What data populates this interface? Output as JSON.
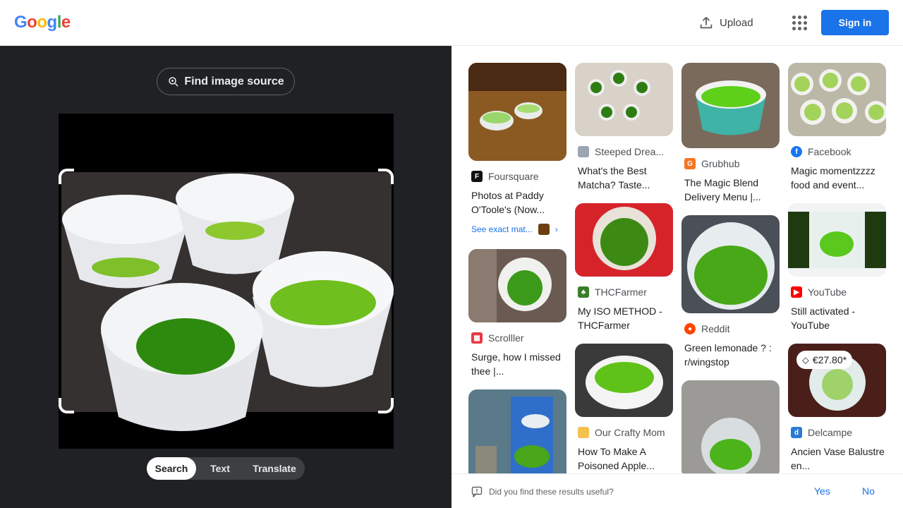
{
  "header": {
    "logo": [
      "G",
      "o",
      "o",
      "g",
      "l",
      "e"
    ],
    "upload_label": "Upload",
    "signin_label": "Sign in"
  },
  "lens": {
    "find_source_label": "Find image source",
    "modes": [
      "Search",
      "Text",
      "Translate"
    ],
    "active_mode": "Search"
  },
  "results": {
    "col1": [
      {
        "source": "Foursquare",
        "title": "Photos at Paddy O'Toole's (Now...",
        "exact_label": "See exact mat..."
      },
      {
        "source": "Scrolller",
        "title": "Surge, how I missed thee |..."
      },
      {
        "source": "",
        "title": ""
      }
    ],
    "col2": [
      {
        "source": "Steeped Drea...",
        "title": "What's the Best Matcha? Taste..."
      },
      {
        "source": "THCFarmer",
        "title": "My ISO METHOD - THCFarmer"
      },
      {
        "source": "Our Crafty Mom",
        "title": "How To Make A Poisoned Apple..."
      }
    ],
    "col3": [
      {
        "source": "Grubhub",
        "title": "The Magic Blend Delivery Menu |..."
      },
      {
        "source": "Reddit",
        "title": "Green lemonade ? : r/wingstop"
      },
      {
        "source": "",
        "title": ""
      }
    ],
    "col4": [
      {
        "source": "Facebook",
        "title": "Magic momentzzzz food and event..."
      },
      {
        "source": "YouTube",
        "title": "Still activated - YouTube"
      },
      {
        "source": "Delcampe",
        "title": "Ancien Vase Balustre en...",
        "price": "€27.80*"
      }
    ]
  },
  "feedback": {
    "question": "Did you find these results useful?",
    "yes": "Yes",
    "no": "No"
  },
  "colors": {
    "google_blue": "#4285f4",
    "google_red": "#ea4335",
    "google_yellow": "#fbbc05",
    "google_green": "#34a853",
    "signin_bg": "#1a73e8",
    "panel_dark": "#202124",
    "matcha": "#6fbf1f"
  }
}
